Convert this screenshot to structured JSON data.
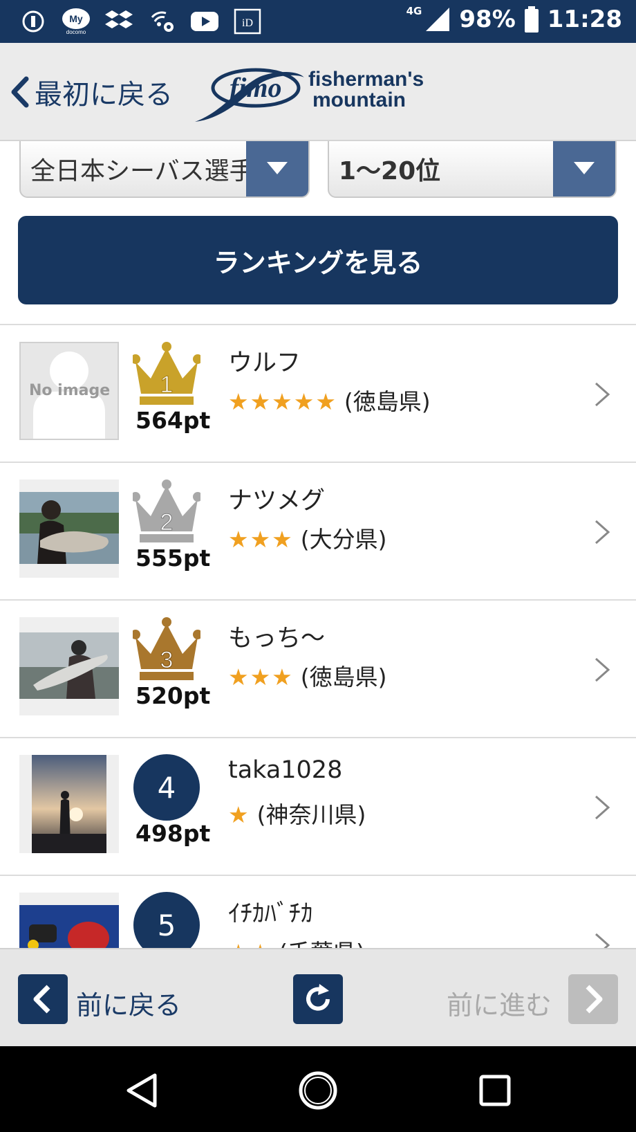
{
  "status_bar": {
    "network": "4G",
    "battery": "98%",
    "time": "11:28",
    "icons": [
      "sync-icon",
      "my-docomo-icon",
      "dropbox-icon",
      "wifi-settings-icon",
      "youtube-icon",
      "id-icon",
      "signal-icon",
      "battery-icon"
    ]
  },
  "header": {
    "back_label": "最初に戻る",
    "logo_script": "fimo",
    "logo_line1": "fisherman's",
    "logo_line2": "mountain"
  },
  "filters": {
    "tournament": "全日本シーバス選手",
    "range": "1〜20位"
  },
  "submit_label": "ランキングを見る",
  "rankings": [
    {
      "rank": "1",
      "points": "564pt",
      "name": "ウルフ",
      "stars": "★★★★★",
      "prefecture": "(徳島県)",
      "photo": "No image",
      "badge": "gold-crown"
    },
    {
      "rank": "2",
      "points": "555pt",
      "name": "ナツメグ",
      "stars": "★★★",
      "prefecture": "(大分県)",
      "photo": "",
      "badge": "silver-crown"
    },
    {
      "rank": "3",
      "points": "520pt",
      "name": "もっち〜",
      "stars": "★★★",
      "prefecture": "(徳島県)",
      "photo": "",
      "badge": "bronze-crown"
    },
    {
      "rank": "4",
      "points": "498pt",
      "name": "taka1028",
      "stars": "★",
      "prefecture": "(神奈川県)",
      "photo": "",
      "badge": "circle"
    },
    {
      "rank": "5",
      "points": "",
      "name": "ｲﾁｶﾊﾞﾁｶ",
      "stars": "★★",
      "prefecture": "(千葉県)",
      "photo": "",
      "badge": "circle"
    }
  ],
  "footer": {
    "back_label": "前に戻る",
    "forward_label": "前に進む"
  },
  "colors": {
    "navy": "#17365f",
    "select_arrow": "#4a6894",
    "star": "#f0a020",
    "gold": "#c9a22a",
    "silver": "#a8a8a8",
    "bronze": "#a9772d"
  }
}
